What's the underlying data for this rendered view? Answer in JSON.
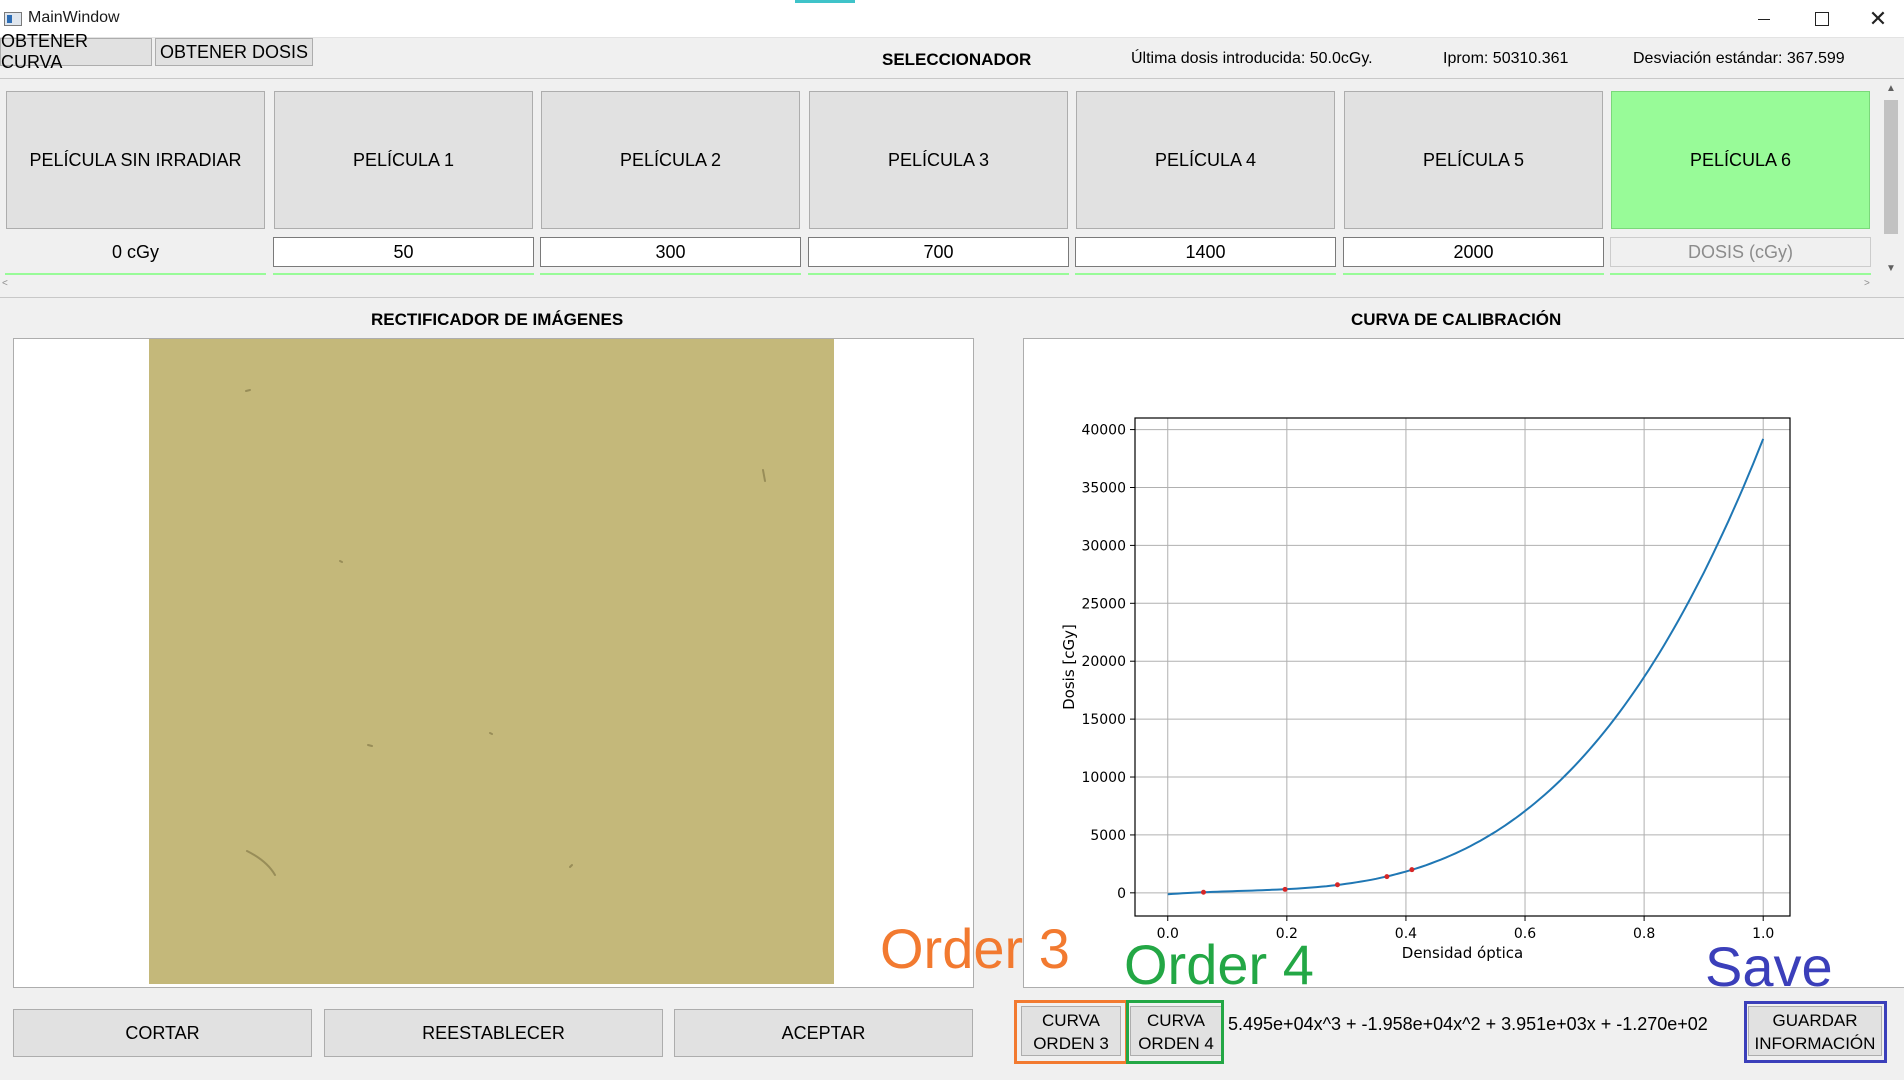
{
  "window": {
    "title": "MainWindow"
  },
  "menu": {
    "tab_curva": "OBTENER CURVA",
    "tab_dosis": "OBTENER DOSIS"
  },
  "header": {
    "selector_title": "SELECCIONADOR",
    "ultima_dosis": "Última dosis introducida: 50.0cGy.",
    "iprom": "Iprom: 50310.361",
    "desviacion": "Desviación estándar: 367.599"
  },
  "films": [
    {
      "label": "PELÍCULA SIN IRRADIAR",
      "dose": "0 cGy"
    },
    {
      "label": "PELÍCULA 1",
      "dose": "50"
    },
    {
      "label": "PELÍCULA 2",
      "dose": "300"
    },
    {
      "label": "PELÍCULA 3",
      "dose": "700"
    },
    {
      "label": "PELÍCULA 4",
      "dose": "1400"
    },
    {
      "label": "PELÍCULA 5",
      "dose": "2000"
    },
    {
      "label": "PELÍCULA 6",
      "dose_placeholder": "DOSIS (cGy)"
    }
  ],
  "active_color": "#98fb98",
  "sections": {
    "rectifier_title": "RECTIFICADOR DE IMÁGENES",
    "curve_title": "CURVA DE CALIBRACIÓN"
  },
  "buttons": {
    "cortar": "CORTAR",
    "reestablecer": "REESTABLECER",
    "aceptar": "ACEPTAR",
    "orden3_l1": "CURVA",
    "orden3_l2": "ORDEN 3",
    "orden4_l1": "CURVA",
    "orden4_l2": "ORDEN 4",
    "guardar_l1": "GUARDAR",
    "guardar_l2": "INFORMACIÓN"
  },
  "equation": "5.495e+04x^3 + -1.958e+04x^2 + 3.951e+03x + -1.270e+02",
  "annotations": {
    "order3": "Order 3",
    "order4": "Order 4",
    "save": "Save"
  },
  "film_color": "#c4b87a",
  "chart_data": {
    "type": "line",
    "xlabel": "Densidad óptica",
    "ylabel": "Dosis [cGy]",
    "xlim": [
      -0.055,
      1.045
    ],
    "ylim": [
      -2000,
      41000
    ],
    "xticks": [
      0.0,
      0.2,
      0.4,
      0.6,
      0.8,
      1.0
    ],
    "xtick_labels": [
      "0.0",
      "0.2",
      "0.4",
      "0.6",
      "0.8",
      "1.0"
    ],
    "yticks": [
      0,
      5000,
      10000,
      15000,
      20000,
      25000,
      30000,
      35000,
      40000
    ],
    "ytick_labels": [
      "0",
      "5000",
      "10000",
      "15000",
      "20000",
      "25000",
      "30000",
      "35000",
      "40000"
    ],
    "grid": true,
    "fit_coefficients": [
      54950,
      -19580,
      3951,
      -127
    ],
    "fit_x_range": [
      0,
      1.0
    ],
    "line_color": "#1f77b4",
    "points_color": "#d62728",
    "points": [
      {
        "x": 0.06,
        "y": 50
      },
      {
        "x": 0.197,
        "y": 300
      },
      {
        "x": 0.285,
        "y": 700
      },
      {
        "x": 0.368,
        "y": 1400
      },
      {
        "x": 0.41,
        "y": 2000
      }
    ]
  }
}
